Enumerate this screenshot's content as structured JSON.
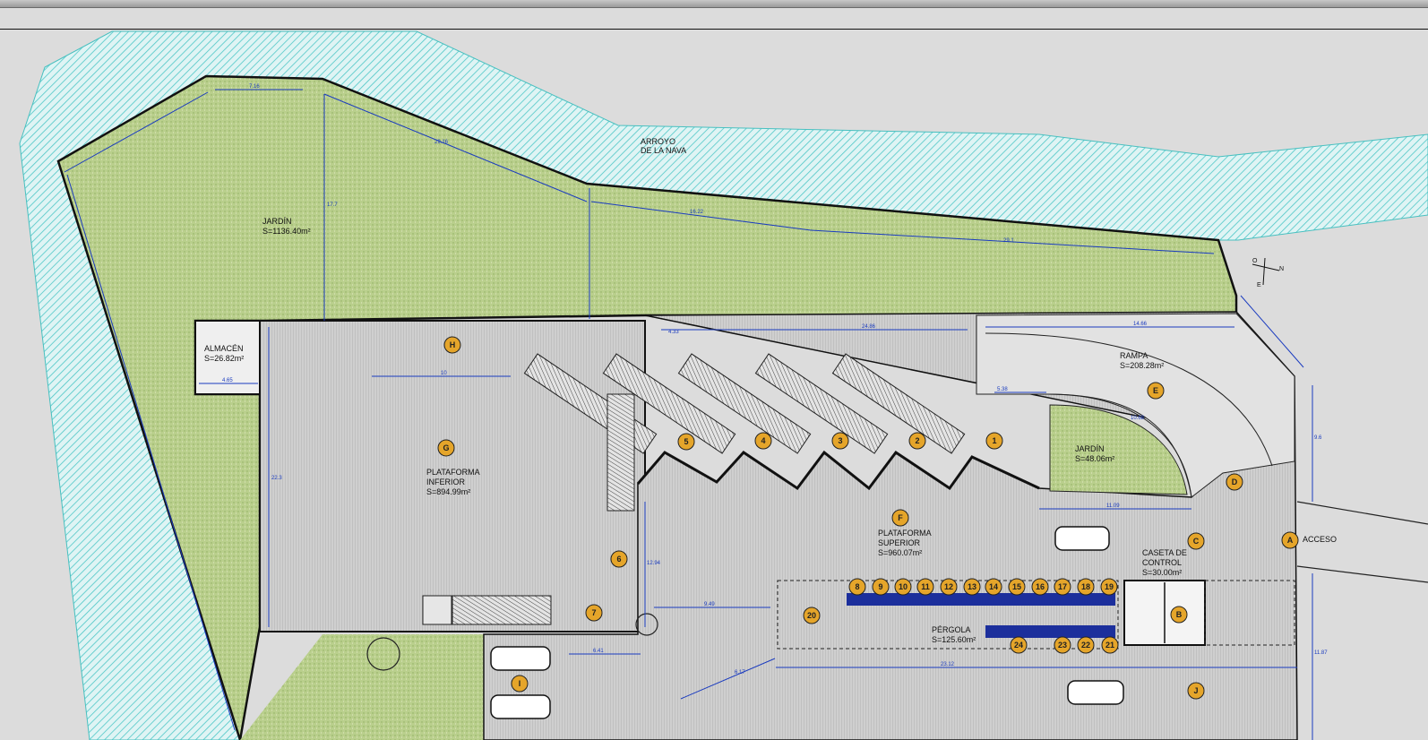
{
  "colors": {
    "water": "#6fd5d5",
    "garden": "#b6cc8a",
    "paving": "#c9c9c9",
    "dimension": "#1a3bbf",
    "marker": "#e5a52a",
    "seat": "#1c2f9c"
  },
  "labels": {
    "stream_line1": "ARROYO",
    "stream_line2": "DE LA NAVA",
    "garden_main_name": "JARDÍN",
    "garden_main_area": "S=1136.40m²",
    "store_name": "ALMACÉN",
    "store_area": "S=26.82m²",
    "lower_line1": "PLATAFORMA",
    "lower_line2": "INFERIOR",
    "lower_area": "S=894.99m²",
    "upper_line1": "PLATAFORMA",
    "upper_line2": "SUPERIOR",
    "upper_area": "S=960.07m²",
    "ramp_name": "RAMPA",
    "ramp_area": "S=208.28m²",
    "garden_small_name": "JARDÍN",
    "garden_small_area": "S=48.06m²",
    "cabin_line1": "CASETA DE",
    "cabin_line2": "CONTROL",
    "cabin_area": "S=30.00m²",
    "pergola_name": "PÉRGOLA",
    "pergola_area": "S=125.60m²",
    "access": "ACCESO"
  },
  "markers": {
    "H": "H",
    "G": "G",
    "F": "F",
    "E": "E",
    "D": "D",
    "C": "C",
    "A": "A",
    "J": "J",
    "B": "B",
    "I": "I",
    "m1": "1",
    "m2": "2",
    "m3": "3",
    "m4": "4",
    "m5": "5",
    "m6": "6",
    "m7": "7",
    "m8": "8",
    "m9": "9",
    "m10": "10",
    "m11": "11",
    "m12": "12",
    "m13": "13",
    "m14": "14",
    "m15": "15",
    "m16": "16",
    "m17": "17",
    "m18": "18",
    "m19": "19",
    "m20": "20",
    "m21": "21",
    "m22": "22",
    "m23": "23",
    "m24": "24"
  },
  "dimensions": {
    "d_7_16": "7.16",
    "d_29_16": "29.16",
    "d_16_22": "16.22",
    "d_29_1": "29.1",
    "d_17_7": "17.7",
    "d_4_65": "4.65",
    "d_10": "10",
    "d_22_3": "22.3",
    "d_14_66": "14.66",
    "d_5_38": "5.38",
    "d_11_09": "11.09",
    "d_10_68": "10.68",
    "d_23_12": "23.12",
    "d_6_41": "6.41",
    "d_9_49": "9.49",
    "d_4_33": "4.33",
    "d_24_86": "24.86",
    "d_9_6": "9.6",
    "d_11_87": "11.87",
    "d_6_17": "6.17",
    "d_12_94": "12.94"
  },
  "compass": {
    "n": "N",
    "e": "E",
    "o": "O"
  }
}
